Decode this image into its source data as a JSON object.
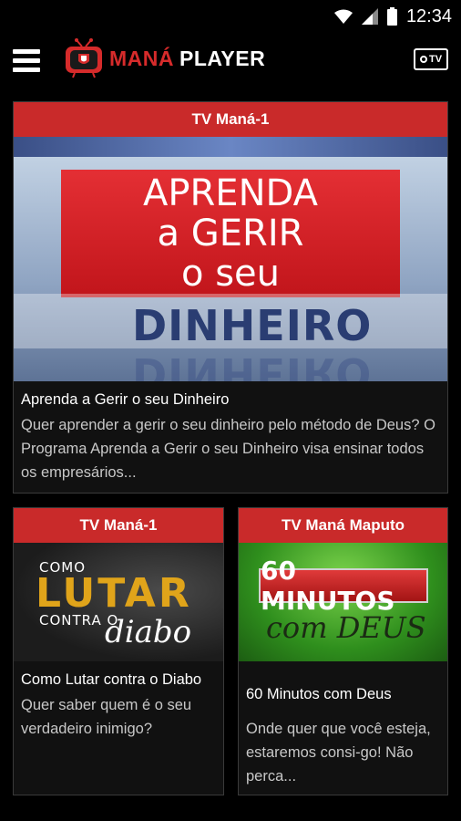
{
  "status_bar": {
    "time": "12:34"
  },
  "app_bar": {
    "brand_red": "MANÁ",
    "brand_white": "PLAYER",
    "tv_button_text": "TV"
  },
  "cards": [
    {
      "channel": "TV Maná-1",
      "thumbnail": {
        "line1": "APRENDA",
        "line2": "a GERIR",
        "line3": "o seu",
        "highlight": "DINHEIRO"
      },
      "title": "Aprenda a Gerir o seu Dinheiro",
      "description": "Quer aprender a gerir o seu dinheiro pelo método de Deus? O Programa Aprenda a Gerir o seu Dinheiro visa ensinar todos os empresários..."
    },
    {
      "channel": "TV Maná-1",
      "thumbnail": {
        "small1": "COMO",
        "big": "LUTAR",
        "small2": "CONTRA O",
        "script": "diabo"
      },
      "title": "Como Lutar contra o Diabo",
      "description": "Quer saber quem é o seu verdadeiro inimigo?"
    },
    {
      "channel": "TV Maná Maputo",
      "thumbnail": {
        "box": "60 MINUTOS",
        "script": "com DEUS"
      },
      "title": "60 Minutos com Deus",
      "description": "Onde quer que você esteja, estaremos consi-go! Não perca..."
    }
  ],
  "colors": {
    "accent": "#c92a2a",
    "background": "#000000"
  }
}
